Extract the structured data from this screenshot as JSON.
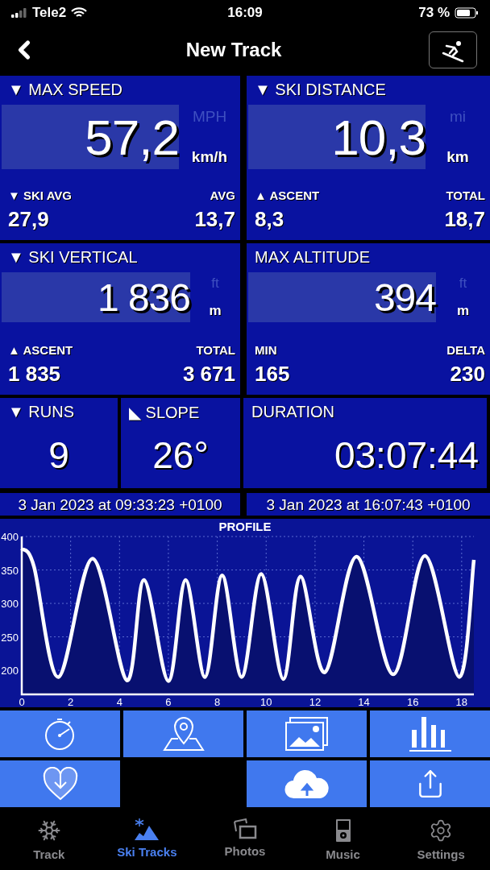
{
  "status_bar": {
    "carrier": "Tele2",
    "time": "16:09",
    "battery": "73 %"
  },
  "nav": {
    "title": "New Track"
  },
  "detail_panels": [
    {
      "title": "▼ MAX SPEED",
      "value": "57,2",
      "alt_unit": "MPH",
      "unit": "km/h",
      "left_label": "▼ SKI AVG",
      "left_value": "27,9",
      "right_label": "AVG",
      "right_value": "13,7"
    },
    {
      "title": "▼ SKI DISTANCE",
      "value": "10,3",
      "alt_unit": "mi",
      "unit": "km",
      "left_label": "▲ ASCENT",
      "left_value": "8,3",
      "right_label": "TOTAL",
      "right_value": "18,7"
    },
    {
      "title": "▼ SKI VERTICAL",
      "value": "1 836",
      "alt_unit": "ft",
      "unit": "m",
      "left_label": "▲ ASCENT",
      "left_value": "1 835",
      "right_label": "TOTAL",
      "right_value": "3 671"
    },
    {
      "title": "MAX ALTITUDE",
      "value": "394",
      "alt_unit": "ft",
      "unit": "m",
      "left_label": "MIN",
      "left_value": "165",
      "right_label": "DELTA",
      "right_value": "230"
    }
  ],
  "summary_panels": [
    {
      "kind": "centered",
      "title": "▼ RUNS",
      "value": "9"
    },
    {
      "kind": "centered",
      "title": "◣ SLOPE",
      "value": "26°"
    },
    {
      "kind": "wide",
      "title": "DURATION",
      "value": "03:07:44"
    }
  ],
  "dates": [
    "3 Jan 2023 at 09:33:23 +0100",
    "3 Jan 2023 at 16:07:43 +0100"
  ],
  "profile": {
    "chart_data": {
      "type": "area",
      "title": "PROFILE",
      "x": [
        0,
        0.5,
        1.5,
        2.9,
        4.3,
        5.0,
        6.0,
        6.7,
        7.5,
        8.2,
        9.0,
        9.8,
        10.7,
        11.4,
        12.4,
        13.7,
        15.2,
        16.5,
        17.9,
        18.5
      ],
      "series": [
        {
          "color": "#ffffff",
          "values": [
            382,
            355,
            190,
            367,
            185,
            335,
            184,
            335,
            190,
            342,
            190,
            344,
            187,
            340,
            197,
            370,
            194,
            371,
            190,
            365
          ]
        }
      ],
      "xlim": [
        0,
        18.5
      ],
      "ylim": [
        164,
        400
      ],
      "xticks": [
        0,
        2,
        4,
        6,
        8,
        10,
        12,
        14,
        16,
        18
      ],
      "yticks": [
        200,
        250,
        300,
        350,
        400
      ],
      "grid": true
    }
  },
  "tabs": [
    {
      "label": "Track",
      "selected": false
    },
    {
      "label": "Ski Tracks",
      "selected": true
    },
    {
      "label": "Photos",
      "selected": false
    },
    {
      "label": "Music",
      "selected": false
    },
    {
      "label": "Settings",
      "selected": false
    }
  ]
}
